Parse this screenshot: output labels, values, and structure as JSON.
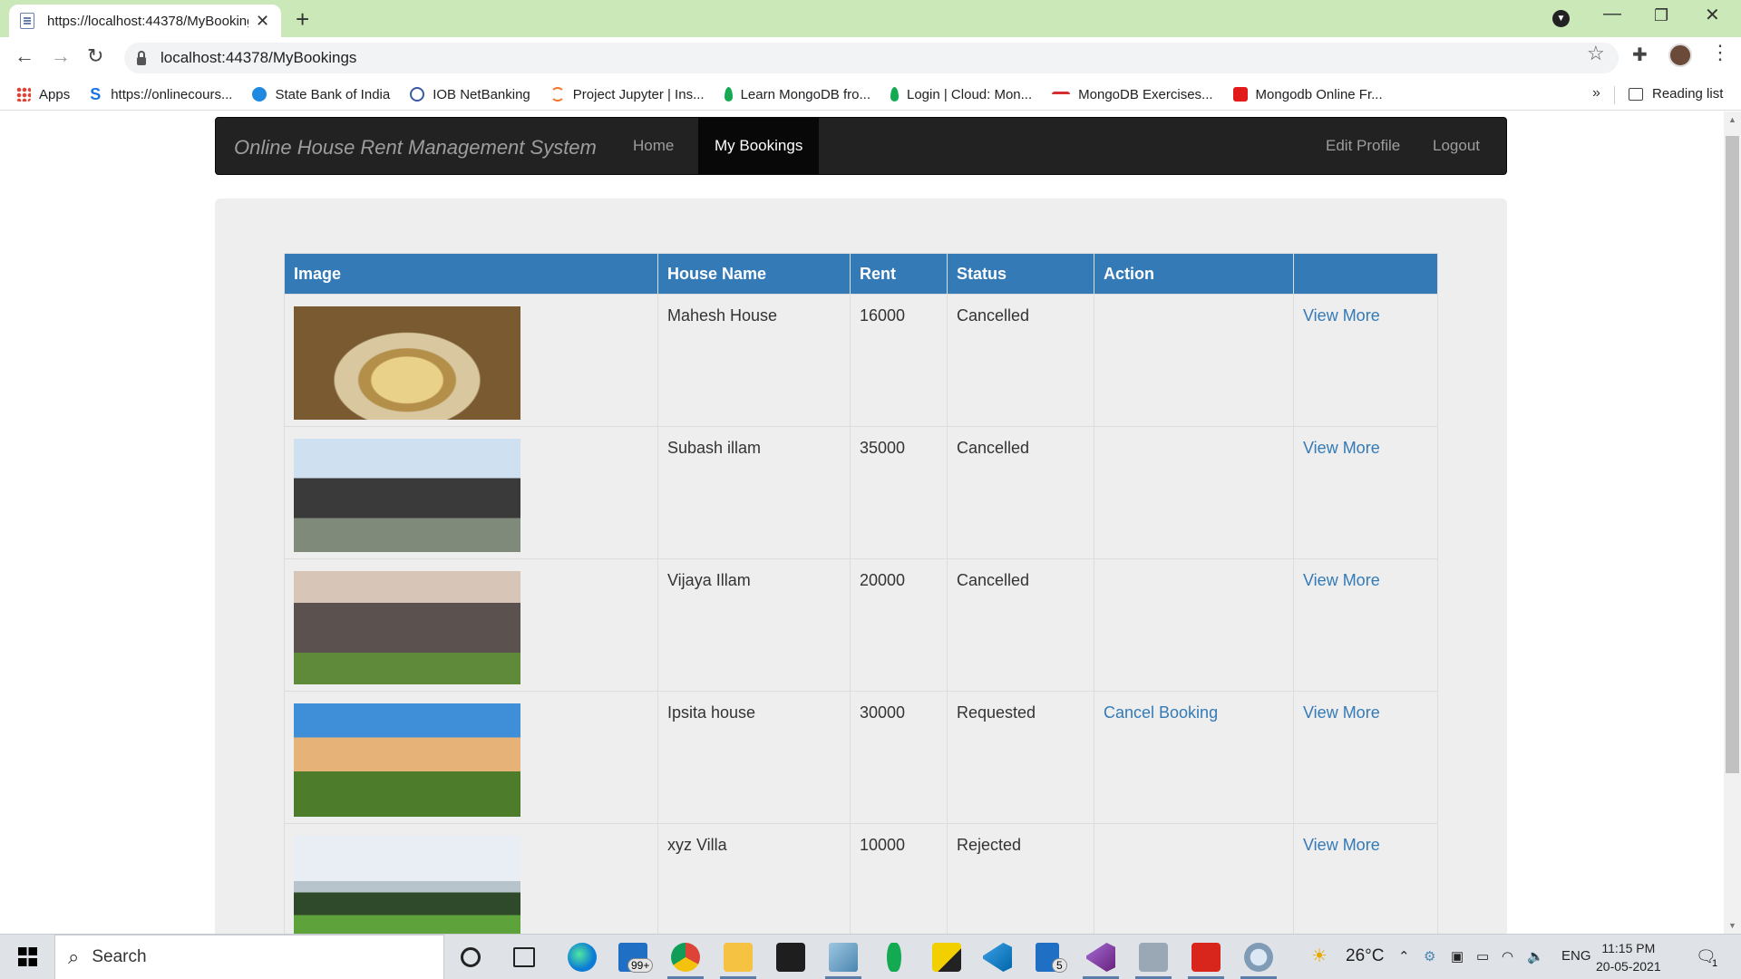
{
  "browser": {
    "tab_title": "https://localhost:44378/MyBookings",
    "url": "localhost:44378/MyBookings",
    "bookmarks": [
      {
        "label": "Apps",
        "icon": "apps-grid-icon",
        "color": "#e34133"
      },
      {
        "label": "https://onlinecours...",
        "icon": "s-logo-icon",
        "color": "#1a73e8"
      },
      {
        "label": "State Bank of India",
        "icon": "sbi-icon",
        "color": "#1f8ae0"
      },
      {
        "label": "IOB NetBanking",
        "icon": "iob-icon",
        "color": "#3b5aa0"
      },
      {
        "label": "Project Jupyter | Ins...",
        "icon": "jupyter-icon",
        "color": "#f37726"
      },
      {
        "label": "Learn MongoDB fro...",
        "icon": "mongodb-leaf-icon",
        "color": "#13aa52"
      },
      {
        "label": "Login | Cloud: Mon...",
        "icon": "mongodb-leaf-icon",
        "color": "#13aa52"
      },
      {
        "label": "MongoDB Exercises...",
        "icon": "w3resource-icon",
        "color": "#d32f2f"
      },
      {
        "label": "Mongodb Online Fr...",
        "icon": "job-icon",
        "color": "#e21b1b"
      }
    ],
    "more_label": "»",
    "reading_list": "Reading list"
  },
  "navbar": {
    "brand": "Online House Rent Management System",
    "links": [
      "Home",
      "My Bookings"
    ],
    "right_links": [
      "Edit Profile",
      "Logout"
    ]
  },
  "table": {
    "headers": [
      "Image",
      "House Name",
      "Rent",
      "Status",
      "Action",
      ""
    ],
    "rows": [
      {
        "name": "Mahesh House",
        "rent": "16000",
        "status": "Cancelled",
        "action": "",
        "link": "View More"
      },
      {
        "name": "Subash illam",
        "rent": "35000",
        "status": "Cancelled",
        "action": "",
        "link": "View More"
      },
      {
        "name": "Vijaya Illam",
        "rent": "20000",
        "status": "Cancelled",
        "action": "",
        "link": "View More"
      },
      {
        "name": "Ipsita house",
        "rent": "30000",
        "status": "Requested",
        "action": "Cancel Booking",
        "link": "View More"
      },
      {
        "name": "xyz Villa",
        "rent": "10000",
        "status": "Rejected",
        "action": "",
        "link": "View More"
      }
    ]
  },
  "taskbar": {
    "search_placeholder": "Search",
    "mail_badge": "99+",
    "files_badge": "5",
    "temperature": "26°C",
    "language": "ENG",
    "time": "11:15 PM",
    "date": "20-05-2021",
    "notification_count": "1"
  },
  "colors": {
    "accent": "#337ab7",
    "navbar_bg": "#222222",
    "tabstrip_bg": "#cbe8b9"
  }
}
